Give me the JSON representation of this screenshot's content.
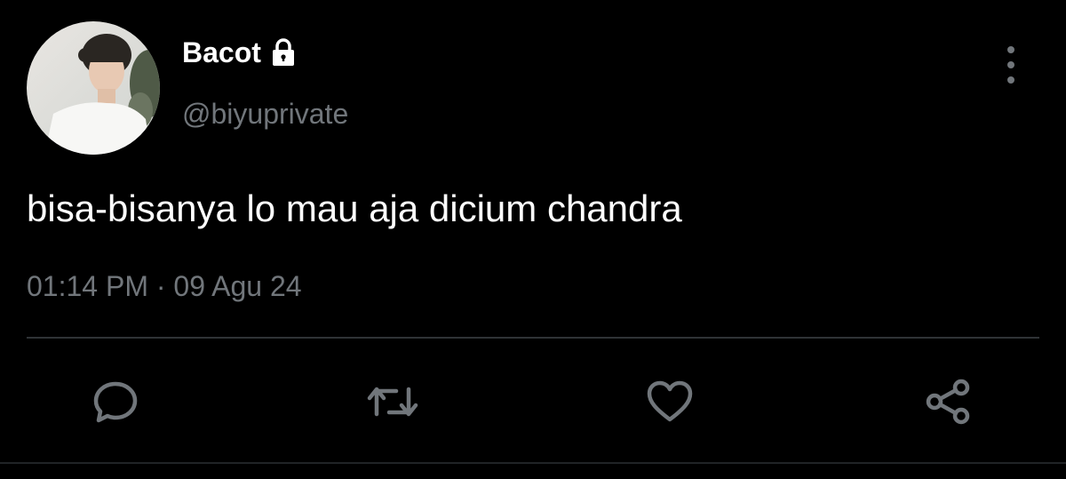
{
  "user": {
    "display_name": "Bacot",
    "handle": "@biyuprivate",
    "protected_icon": "lock-icon",
    "avatar_icon": "profile-photo"
  },
  "tweet": {
    "text": "bisa-bisanya lo mau aja dicium chandra",
    "timestamp": "01:14 PM · 09 Agu 24"
  },
  "actions": [
    {
      "name": "reply",
      "icon": "speech-bubble-icon"
    },
    {
      "name": "retweet",
      "icon": "retweet-icon"
    },
    {
      "name": "like",
      "icon": "heart-icon"
    },
    {
      "name": "share",
      "icon": "share-icon"
    }
  ],
  "more_icon": "vertical-dots-icon",
  "colors": {
    "background": "#000000",
    "primary_text": "#ffffff",
    "secondary_text": "#71767b",
    "divider": "#2f3336"
  }
}
